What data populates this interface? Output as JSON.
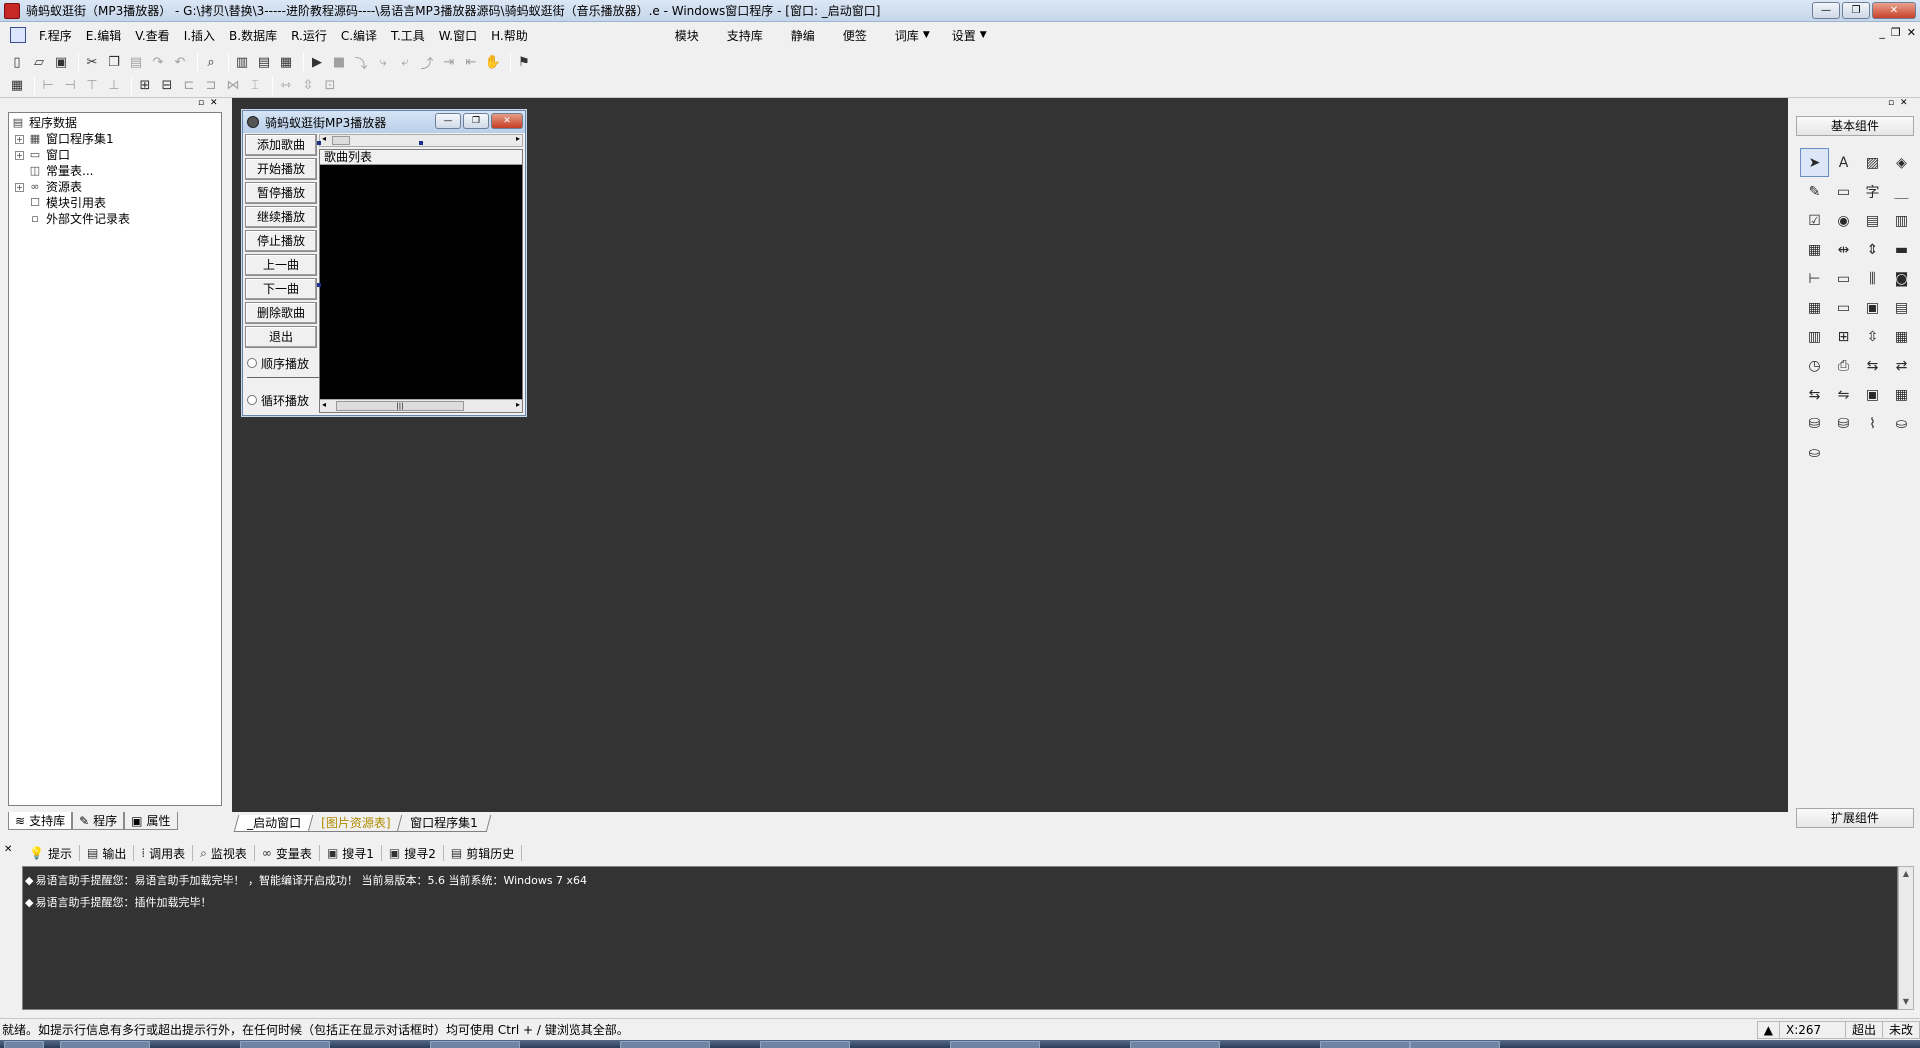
{
  "window": {
    "title": "骑蚂蚁逛街（MP3播放器） - G:\\拷贝\\替换\\3-----进阶教程源码----\\易语言MP3播放器源码\\骑蚂蚁逛街（音乐播放器）.e - Windows窗口程序 - [窗口: _启动窗口]",
    "min_label": "—",
    "restore_label": "❐",
    "close_label": "✕"
  },
  "menu": {
    "items": [
      "F.程序",
      "E.编辑",
      "V.查看",
      "I.插入",
      "B.数据库",
      "R.运行",
      "C.编译",
      "T.工具",
      "W.窗口",
      "H.帮助"
    ],
    "right_items": [
      "模块",
      "支持库",
      "静编",
      "便签",
      "词库",
      "设置"
    ],
    "dropdown_caret": "▼",
    "mdi_min": "_",
    "mdi_restore": "❐",
    "mdi_close": "✕"
  },
  "tree": {
    "items": [
      {
        "label": "程序数据",
        "expander": "",
        "icon": "▤"
      },
      {
        "label": "窗口程序集1",
        "expander": "+",
        "icon": "▦"
      },
      {
        "label": "窗口",
        "expander": "+",
        "icon": "▭"
      },
      {
        "label": "常量表...",
        "expander": "",
        "icon": "◫"
      },
      {
        "label": "资源表",
        "expander": "+",
        "icon": "∞"
      },
      {
        "label": "模块引用表",
        "expander": "",
        "icon": "☐"
      },
      {
        "label": "外部文件记录表",
        "expander": "",
        "icon": "▫"
      }
    ]
  },
  "left_tabs": [
    {
      "label": "支持库",
      "icon": "≋"
    },
    {
      "label": "程序",
      "icon": "✎"
    },
    {
      "label": "属性",
      "icon": "▣"
    }
  ],
  "child_window": {
    "title": "骑蚂蚁逛街MP3播放器",
    "buttons": [
      "添加歌曲",
      "开始播放",
      "暂停播放",
      "继续播放",
      "停止播放",
      "上一曲",
      "下一曲",
      "删除歌曲",
      "退出"
    ],
    "radios": [
      "顺序播放",
      "循环播放"
    ],
    "list_header": "歌曲列表",
    "scroll_left": "◂",
    "scroll_right": "▸",
    "scroll_grip": "|||"
  },
  "design_tabs": [
    {
      "label": "_启动窗口",
      "state": "active"
    },
    {
      "label": "[图片资源表]",
      "state": "yellow"
    },
    {
      "label": "窗口程序集1",
      "state": "normal"
    }
  ],
  "component_panel": {
    "header": "基本组件",
    "footer": "扩展组件",
    "icons": [
      "pointer-icon",
      "label-icon",
      "picture-icon",
      "shape-icon",
      "edit-icon",
      "frame-icon",
      "text-icon",
      "line-icon",
      "checkbox-icon",
      "radio-icon",
      "combobox-icon",
      "listbox-icon",
      "multilist-icon",
      "hscroll-icon",
      "vscroll-icon",
      "progress-icon",
      "slider-icon",
      "tabs-icon",
      "splitter-icon",
      "image-icon",
      "dateedit-icon",
      "statusbar-icon",
      "folder-icon",
      "doc-icon",
      "toolbar-icon",
      "treeview-icon",
      "updown-icon",
      "calendar-icon",
      "timer-icon",
      "printer-icon",
      "network-icon",
      "network2-icon",
      "server-icon",
      "client-icon",
      "frame2-icon",
      "grid-icon",
      "db-icon",
      "db2-icon",
      "chart-icon",
      "odbc-icon",
      "odbc2-icon"
    ],
    "glyphs": [
      "➤",
      "A",
      "▨",
      "◈",
      "✎",
      "▭",
      "字",
      "＿",
      "☑",
      "◉",
      "▤",
      "▥",
      "▦",
      "⇹",
      "⇕",
      "▬",
      "⊢",
      "▭",
      "⫼",
      "◙",
      "▦",
      "▭",
      "▣",
      "▤",
      "▥",
      "⊞",
      "⇳",
      "▦",
      "◷",
      "⎙",
      "⇆",
      "⇄",
      "⇆",
      "⇋",
      "▣",
      "▦",
      "⛁",
      "⛁",
      "⌇",
      "⛀",
      "⛀"
    ]
  },
  "output": {
    "tabs": [
      {
        "label": "提示",
        "icon": "💡"
      },
      {
        "label": "输出",
        "icon": "▤"
      },
      {
        "label": "调用表",
        "icon": "⁞"
      },
      {
        "label": "监视表",
        "icon": "⌕"
      },
      {
        "label": "变量表",
        "icon": "∞"
      },
      {
        "label": "搜寻1",
        "icon": "▣"
      },
      {
        "label": "搜寻2",
        "icon": "▣"
      },
      {
        "label": "剪辑历史",
        "icon": "▤"
      }
    ],
    "lines": [
      "易语言助手提醒您：易语言助手加载完毕！ ，智能编译开启成功！  当前易版本：5.6  当前系统：Windows 7 x64",
      "易语言助手提醒您：插件加载完毕！"
    ],
    "bullet": "◆",
    "close_label": "✕",
    "scroll_up": "▲",
    "scroll_down": "▼"
  },
  "status": {
    "message": "就绪。如提示行信息有多行或超出提示行外，在任何时候（包括正在显示对话框时）均可使用 Ctrl + / 键浏览其全部。",
    "coord": "X:267",
    "mode": "超出",
    "modified": "未改"
  },
  "colors": {
    "design_bg": "#333333",
    "title_gradient_top": "#dbe7f5",
    "close_red": "#c8412a",
    "selection_handle": "#1c2f8a"
  }
}
